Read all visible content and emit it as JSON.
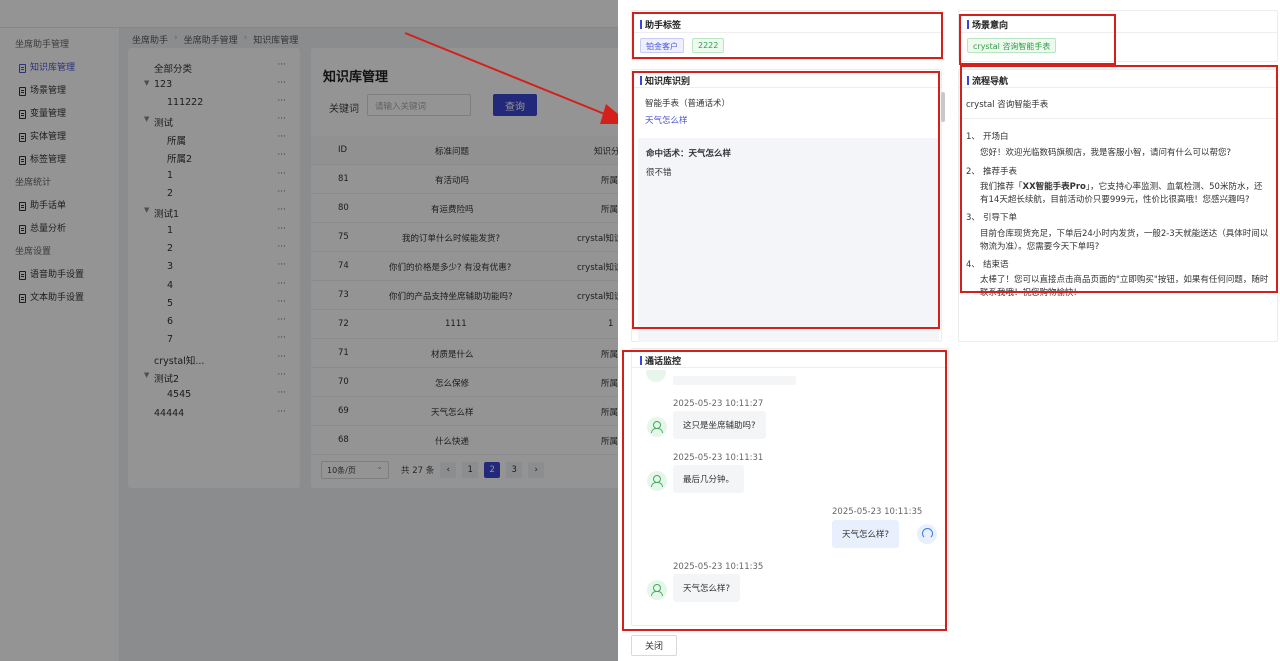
{
  "sidebar": {
    "groups": [
      {
        "title": "坐席助手管理",
        "items": [
          "知识库管理",
          "场景管理",
          "变量管理",
          "实体管理",
          "标签管理"
        ]
      },
      {
        "title": "坐席统计",
        "items": [
          "助手话单",
          "总量分析"
        ]
      },
      {
        "title": "坐席设置",
        "items": [
          "语音助手设置",
          "文本助手设置"
        ]
      }
    ]
  },
  "breadcrumb": [
    "坐席助手",
    "坐席助手管理",
    "知识库管理"
  ],
  "tree": {
    "more": "···",
    "items": [
      "全部分类",
      "123",
      "111222",
      "测试",
      "所属",
      "所属2",
      "1",
      "2",
      "测试1",
      "1",
      "2",
      "3",
      "4",
      "5",
      "6",
      "7",
      "crystal知...",
      "测试2",
      "4545",
      "44444"
    ]
  },
  "kb": {
    "title": "知识库管理",
    "keyword_label": "关键词",
    "keyword_placeholder": "请输入关键词",
    "query_button": "查询",
    "columns": [
      "ID",
      "标准问题",
      "知识分"
    ],
    "rows": [
      {
        "id": "81",
        "q": "有活动吗",
        "c": "所属"
      },
      {
        "id": "80",
        "q": "有运费险吗",
        "c": "所属"
      },
      {
        "id": "75",
        "q": "我的订单什么时候能发货?",
        "c": "crystal知识"
      },
      {
        "id": "74",
        "q": "你们的价格是多少? 有没有优惠?",
        "c": "crystal知识"
      },
      {
        "id": "73",
        "q": "你们的产品支持坐席辅助功能吗?",
        "c": "crystal知识"
      },
      {
        "id": "72",
        "q": "1111",
        "c": "1"
      },
      {
        "id": "71",
        "q": "材质是什么",
        "c": "所属"
      },
      {
        "id": "70",
        "q": "怎么保修",
        "c": "所属"
      },
      {
        "id": "69",
        "q": "天气怎么样",
        "c": "所属"
      },
      {
        "id": "68",
        "q": "什么快递",
        "c": "所属"
      }
    ],
    "page_size": "10条/页",
    "total": "共 27 条",
    "pages": [
      "1",
      "2",
      "3"
    ],
    "prev": "‹",
    "next": "›"
  },
  "drawer": {
    "tags_card": {
      "title": "助手标签",
      "tags": [
        "铂金客户",
        "2222"
      ]
    },
    "scene_card": {
      "title": "场景意向",
      "tag": "crystal 咨询智能手表"
    },
    "kb_card": {
      "title": "知识库识别",
      "item_title": "智能手表（普通话术）",
      "item_link": "天气怎么样",
      "hit_title": "命中话术：天气怎么样",
      "hit_answer": "很不错"
    },
    "flow_card": {
      "title": "流程导航",
      "scene": "crystal 咨询智能手表",
      "steps": [
        {
          "num": "1、",
          "name": "开场白",
          "text": "您好！欢迎光临数码旗舰店，我是客服小智，请问有什么可以帮您?"
        },
        {
          "num": "2、",
          "name": "推荐手表",
          "text_before": "我们推荐「",
          "text_bold": "XX智能手表Pro",
          "text_after": "」，它支持心率监测、血氧检测、50米防水，还有14天超长续航，目前活动价只要999元，性价比很高哦！您感兴趣吗?"
        },
        {
          "num": "3、",
          "name": "引导下单",
          "text": "目前仓库现货充足，下单后24小时内发货，一般2-3天就能送达（具体时间以物流为准）。您需要今天下单吗?"
        },
        {
          "num": "4、",
          "name": "结束语",
          "text": "太棒了！您可以直接点击商品页面的\"立即购买\"按钮，如果有任何问题，随时联系我哦！祝您购物愉快!"
        }
      ]
    },
    "monitor_card": {
      "title": "通话监控",
      "messages": [
        {
          "role": "customer",
          "time": "2025-05-23 10:11:27",
          "text": "这只是坐席辅助吗?"
        },
        {
          "role": "customer",
          "time": "2025-05-23 10:11:31",
          "text": "最后几分钟。"
        },
        {
          "role": "agent",
          "time": "2025-05-23 10:11:35",
          "text": "天气怎么样?"
        },
        {
          "role": "customer",
          "time": "2025-05-23 10:11:35",
          "text": "天气怎么样?"
        }
      ]
    },
    "close_button": "关闭"
  },
  "colors": {
    "accent": "#3b47d4",
    "highlight_box": "#d4201a",
    "tag_green": "#2e9e45",
    "tag_blue": "#4a55d6"
  }
}
